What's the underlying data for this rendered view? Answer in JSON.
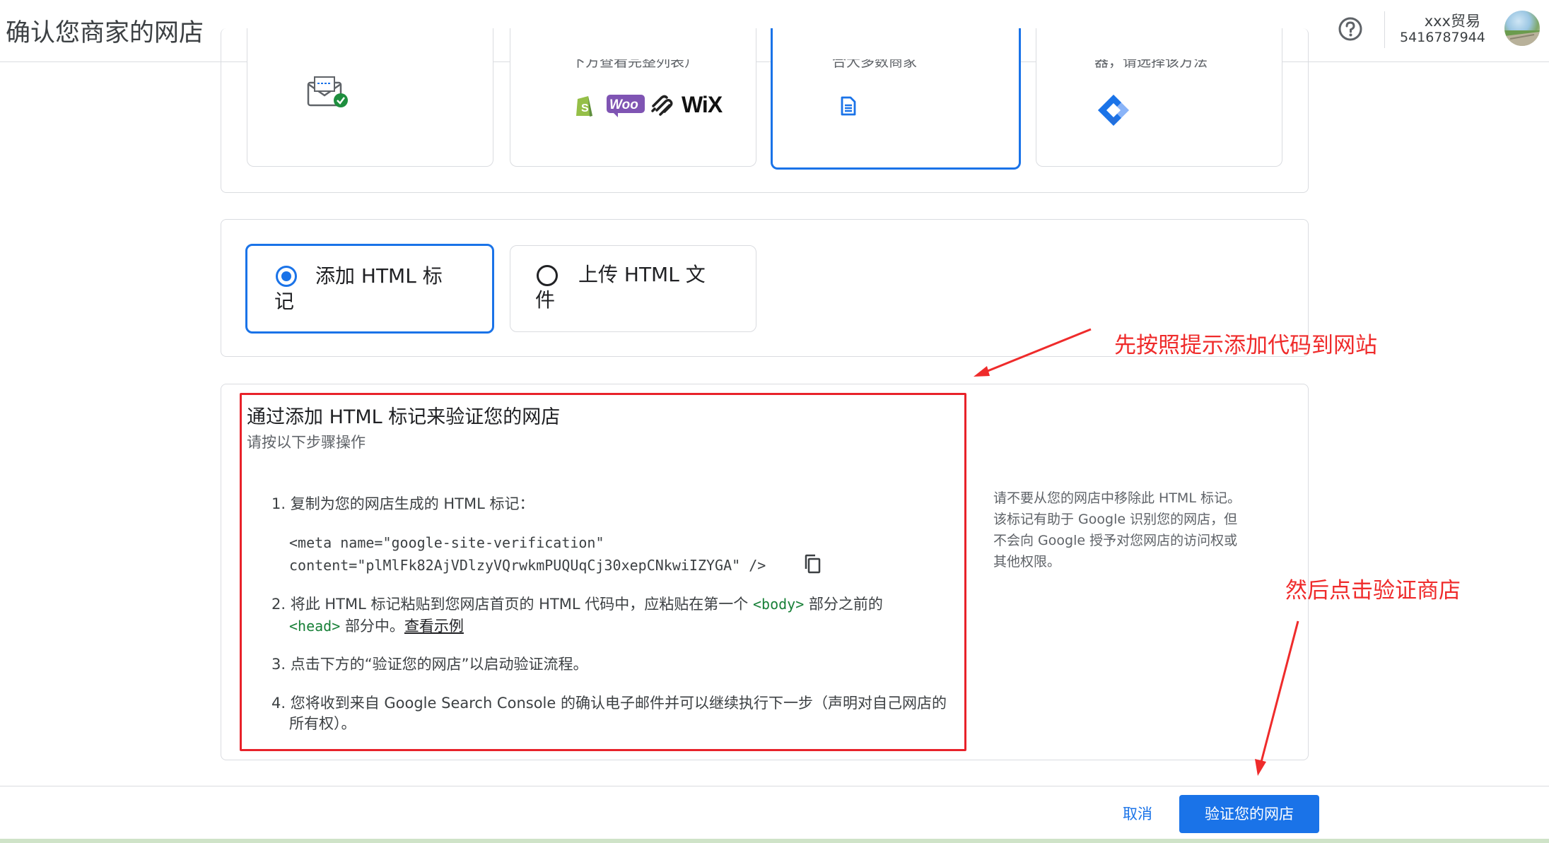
{
  "header": {
    "title": "确认您商家的网店",
    "help_icon": "help-circle-icon",
    "account_name": "xxx贸易",
    "account_id": "5416787944"
  },
  "method_cards": [
    {
      "cut_text": "",
      "icons": [
        "email-verify-icon"
      ]
    },
    {
      "cut_text": "下方查看完整列表）",
      "icons": [
        "shopify-icon",
        "woo-icon",
        "squarespace-icon",
        "wix-icon"
      ],
      "woo_label": "Woo",
      "wix_label": "WiX"
    },
    {
      "cut_text": "合大多数商家",
      "icons": [
        "document-icon"
      ]
    },
    {
      "cut_text": "器，请选择该方法",
      "icons": [
        "tag-manager-icon"
      ]
    }
  ],
  "options": {
    "add_tag": {
      "label_line1": "添加 HTML 标",
      "label_line2": "记",
      "selected": true
    },
    "upload": {
      "label_line1": "上传 HTML 文",
      "label_line2": "件",
      "selected": false
    }
  },
  "instructions": {
    "title": "通过添加 HTML 标记来验证您的网店",
    "subtitle": "请按以下步骤操作",
    "step1": "1. 复制为您的网店生成的 HTML 标记：",
    "code_line1": "<meta name=\"google-site-verification\"",
    "code_line2": "content=\"plMlFk82AjVDlzyVQrwkmPUQUqCj30xepCNkwiIZYGA\" />",
    "step2_a": "2. 将此 HTML 标记粘贴到您网店首页的 HTML 代码中，应粘贴在第一个",
    "step2_body": "<body>",
    "step2_b": "部分之前的",
    "step2_head": "<head>",
    "step2_c": "部分中。",
    "step2_link": "查看示例",
    "step3": "3. 点击下方的“验证您的网店”以启动验证流程。",
    "step4_line1": "4. 您将收到来自 Google Search Console 的确认电子邮件并可以继续执行下一步（声明对自己网店的",
    "step4_line2": "所有权）。",
    "side_note": "请不要从您的网店中移除此 HTML 标记。该标记有助于 Google 识别您的网店，但不会向 Google 授予对您网店的访问权或其他权限。"
  },
  "annotations": {
    "note1": "先按照提示添加代码到网站",
    "note2": "然后点击验证商店",
    "color": "#ef2b2b"
  },
  "footer": {
    "cancel_label": "取消",
    "verify_label": "验证您的网店"
  },
  "colors": {
    "accent": "#1a73e8",
    "annotation_red": "#e8222a"
  }
}
